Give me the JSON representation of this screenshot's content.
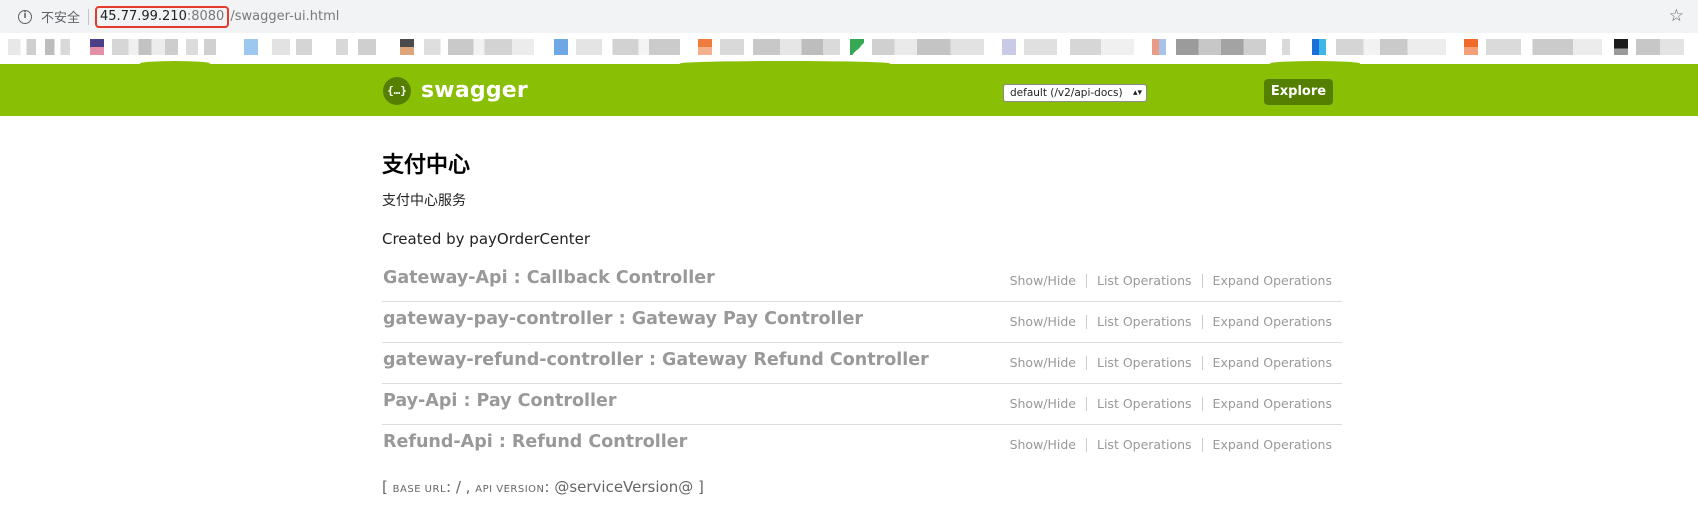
{
  "browser": {
    "insecure_label": "不安全",
    "url_host": "45.77.99.210",
    "url_port": ":8080",
    "url_path": "/swagger-ui.html"
  },
  "header": {
    "logo_symbol": "{…}",
    "logo_text": "swagger",
    "api_select_value": "default (/v2/api-docs)",
    "explore_label": "Explore",
    "brand_color": "#89bf04",
    "button_color": "#547f00"
  },
  "main": {
    "title": "支付中心",
    "description": "支付中心服务",
    "created_by": "Created by payOrderCenter",
    "resources": [
      {
        "title": "Gateway-Api : Callback Controller"
      },
      {
        "title": "gateway-pay-controller : Gateway Pay Controller"
      },
      {
        "title": "gateway-refund-controller : Gateway Refund Controller"
      },
      {
        "title": "Pay-Api : Pay Controller"
      },
      {
        "title": "Refund-Api : Refund Controller"
      }
    ],
    "actions": {
      "show_hide": "Show/Hide",
      "list_operations": "List Operations",
      "expand_operations": "Expand Operations"
    },
    "footer": {
      "open_bracket": "[",
      "base_url_label": "base url",
      "base_url_value": ": / ,",
      "api_version_label": "api version",
      "api_version_value": ": @serviceVersion@",
      "close_bracket": "]"
    }
  }
}
